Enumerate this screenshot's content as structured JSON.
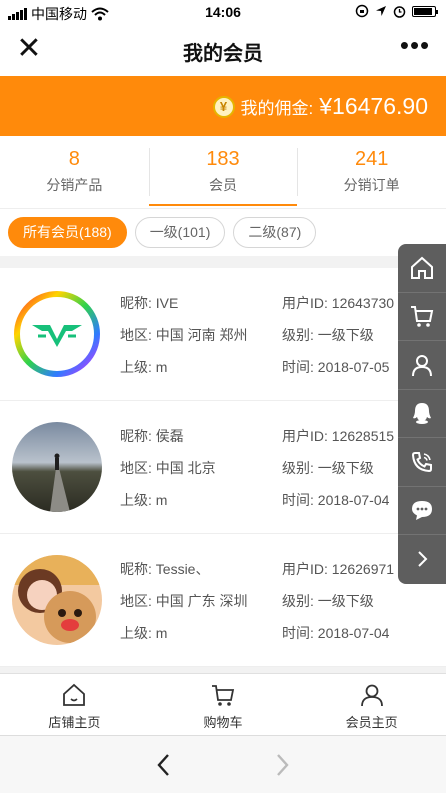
{
  "status": {
    "carrier": "中国移动",
    "time": "14:06"
  },
  "nav": {
    "title": "我的会员"
  },
  "commission": {
    "label": "我的佣金:",
    "value": "¥16476.90"
  },
  "stats": [
    {
      "value": "8",
      "label": "分销产品"
    },
    {
      "value": "183",
      "label": "会员"
    },
    {
      "value": "241",
      "label": "分销订单"
    }
  ],
  "filters": [
    "所有会员(188)",
    "一级(101)",
    "二级(87)"
  ],
  "members": [
    {
      "nickname": "昵称: IVE",
      "uid": "用户ID: 12643730",
      "region": "地区: 中国 河南 郑州",
      "level": "级别: 一级下级",
      "parent": "上级: m",
      "time": "时间: 2018-07-05"
    },
    {
      "nickname": "昵称: 侯磊",
      "uid": "用户ID: 12628515",
      "region": "地区: 中国 北京",
      "level": "级别: 一级下级",
      "parent": "上级: m",
      "time": "时间: 2018-07-04"
    },
    {
      "nickname": "昵称: Tessie、",
      "uid": "用户ID: 12626971",
      "region": "地区: 中国 广东 深圳",
      "level": "级别: 一级下级",
      "parent": "上级: m",
      "time": "时间: 2018-07-04"
    }
  ],
  "tabs": [
    {
      "label": "店铺主页"
    },
    {
      "label": "购物车"
    },
    {
      "label": "会员主页"
    }
  ],
  "colors": {
    "accent": "#ff8a0b",
    "float_bar": "#5e5e5e"
  }
}
